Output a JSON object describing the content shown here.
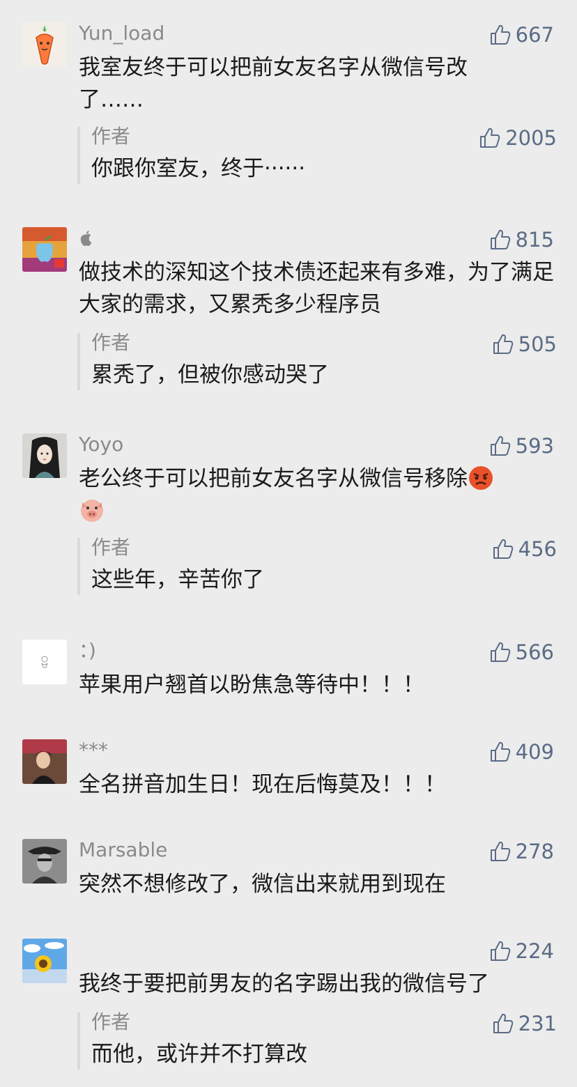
{
  "comments": [
    {
      "name": "Yun_load",
      "likes": "667",
      "text": "我室友终于可以把前女友名字从微信号改了……",
      "reply": {
        "author": "作者",
        "likes": "2005",
        "text": "你跟你室友，终于······"
      }
    },
    {
      "name": "",
      "likes": "815",
      "text": "做技术的深知这个技术债还起来有多难，为了满足大家的需求，又累秃多少程序员",
      "reply": {
        "author": "作者",
        "likes": "505",
        "text": "累秃了，但被你感动哭了"
      }
    },
    {
      "name": "Yoyo",
      "likes": "593",
      "text": "老公终于可以把前女友名字从微信号移除",
      "reply": {
        "author": "作者",
        "likes": "456",
        "text": "这些年，辛苦你了"
      }
    },
    {
      "name": "：)",
      "likes": "566",
      "text": "苹果用户翘首以盼焦急等待中！！！"
    },
    {
      "name": "***",
      "likes": "409",
      "text": "全名拼音加生日！现在后悔莫及！！！"
    },
    {
      "name": "Marsable",
      "likes": "278",
      "text": "突然不想修改了，微信出来就用到现在"
    },
    {
      "name": "",
      "likes": "224",
      "text": "我终于要把前男友的名字踢出我的微信号了",
      "reply": {
        "author": "作者",
        "likes": "231",
        "text": "而他，或许并不打算改"
      }
    }
  ],
  "icons": {
    "like": "thumbs-up-icon",
    "apple": "apple-icon",
    "angry": "angry-face-emoji",
    "pig": "pig-face-emoji"
  },
  "colors": {
    "background": "#ececec",
    "like_text": "#5a6b85",
    "name_text": "#8a8a8a",
    "body_text": "#1a1a1a",
    "reply_bar": "#d9d9d9"
  }
}
